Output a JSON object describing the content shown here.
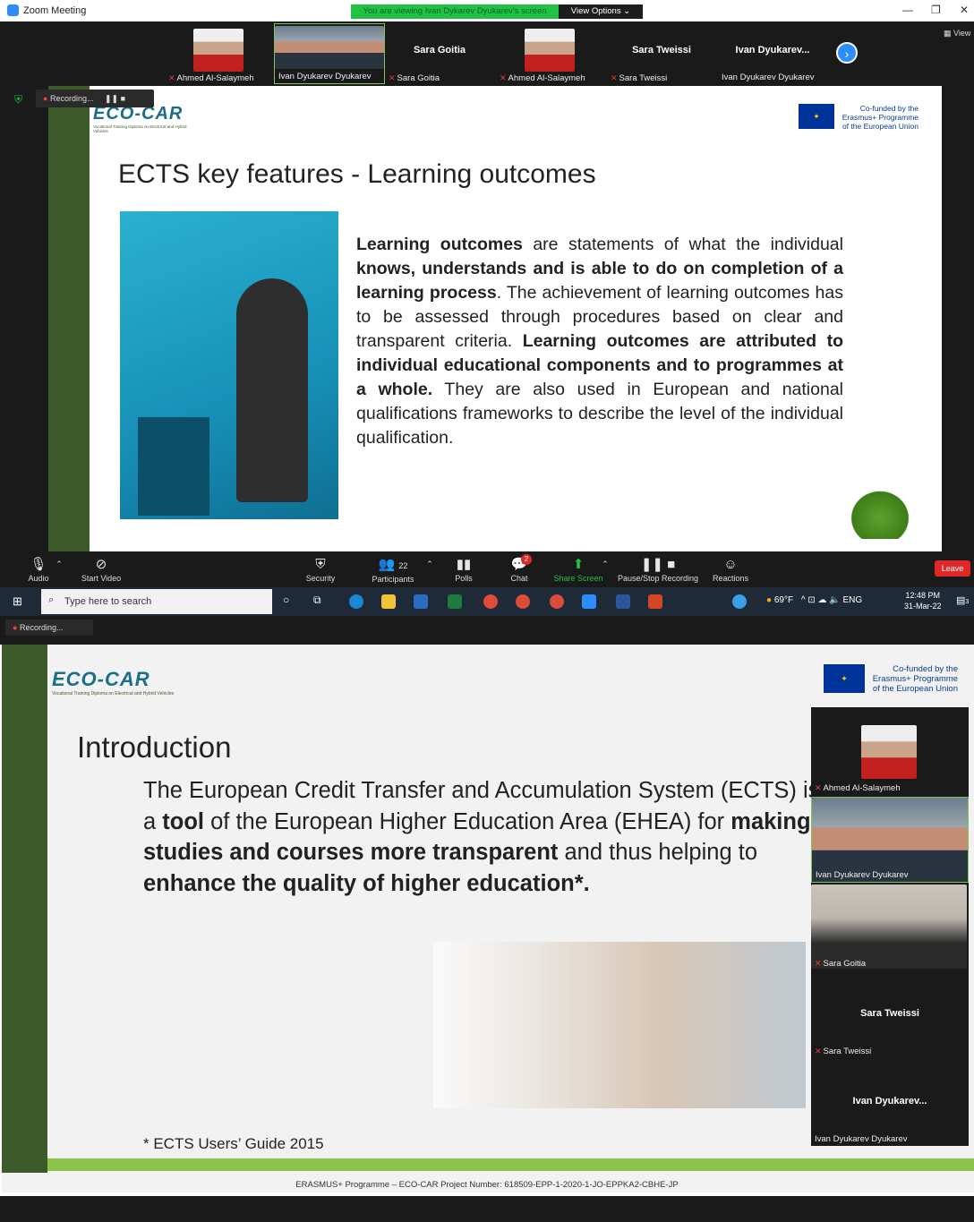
{
  "window": {
    "title": "Zoom Meeting",
    "banner": "You are viewing Ivan Dykarev Dyukarev's screen",
    "view_options": "View Options ⌄",
    "view_label": "View"
  },
  "participants_strip": [
    {
      "name": "Ahmed Al-Salaymeh",
      "muted": true,
      "video": true
    },
    {
      "name": "Ivan Dyukarev Dyukarev",
      "muted": false,
      "video": true
    },
    {
      "name": "Sara Goitia",
      "display": "Sara Goitia",
      "muted": true,
      "video": false
    },
    {
      "name": "Ahmed Al-Salaymeh",
      "muted": true,
      "video": true
    },
    {
      "name": "Sara Tweissi",
      "display": "Sara Tweissi",
      "muted": true,
      "video": false
    },
    {
      "name": "Ivan Dyukarev Dyukarev",
      "display": "Ivan  Dyukarev...",
      "muted": false,
      "video": false
    }
  ],
  "recording_label": "Recording...",
  "slide1": {
    "title": "ECTS key features - Learning outcomes",
    "logo": "ECO-CAR",
    "logo_sub": "Vocational Training Diploma on Electrical and Hybrid Vehicles",
    "cofunded": "Co-funded by the Erasmus+ Programme of the European Union",
    "p": [
      {
        "t": "Learning outcomes",
        "b": true
      },
      {
        "t": " are statements of what the individual ",
        "b": false
      },
      {
        "t": "knows, understands and is able to do on completion of a learning process",
        "b": true
      },
      {
        "t": ". The achievement of learning outcomes has to be assessed through procedures based on clear and transparent criteria. ",
        "b": false
      },
      {
        "t": "Learning outcomes are attributed to individual educational components and to programmes at a whole.",
        "b": true
      },
      {
        "t": " They are also used in European and national qualifications frameworks to describe the level of the individual qualification.",
        "b": false
      }
    ]
  },
  "toolbar": {
    "audio": "Audio",
    "start_video": "Start Video",
    "security": "Security",
    "participants": "Participants",
    "participants_count": "22",
    "polls": "Polls",
    "chat": "Chat",
    "chat_badge": "2",
    "share_screen": "Share Screen",
    "pause_recording": "Pause/Stop Recording",
    "reactions": "Reactions",
    "leave": "Leave"
  },
  "taskbar": {
    "search_placeholder": "Type here to search",
    "temperature": "69°F",
    "lang": "ENG",
    "time": "12:48 PM",
    "date": "31-Mar-22",
    "notif_count": "3"
  },
  "slide2": {
    "title": "Introduction",
    "p": [
      {
        "t": "The European Credit Transfer and Accumulation System (ECTS) is a ",
        "b": false
      },
      {
        "t": "tool",
        "b": true
      },
      {
        "t": " of the European Higher Education Area (EHEA) for ",
        "b": false
      },
      {
        "t": "making studies and courses more transparent",
        "b": true
      },
      {
        "t": " and thus helping to ",
        "b": false
      },
      {
        "t": "enhance the quality of higher education*.",
        "b": true
      }
    ],
    "footnote": "* ECTS Users’ Guide 2015",
    "footer": "ERASMUS+ Programme – ECO-CAR Project Number: 618509-EPP-1-2020-1-JO-EPPKA2-CBHE-JP"
  },
  "side_panel": [
    {
      "name": "Ahmed Al-Salaymeh",
      "muted": true,
      "video": true
    },
    {
      "name": "Ivan Dyukarev Dyukarev",
      "muted": false,
      "video": true
    },
    {
      "name": "Sara Goitia",
      "muted": true,
      "video": true
    },
    {
      "name": "Sara Tweissi",
      "display": "Sara Tweissi",
      "muted": true,
      "video": false
    },
    {
      "name": "Ivan Dyukarev Dyukarev",
      "display": "Ivan  Dyukarev...",
      "muted": false,
      "video": false
    }
  ],
  "colors": {
    "zoom_blue": "#2d8cff",
    "banner_green": "#22c043",
    "leave_red": "#e02828",
    "slide_green": "#3c5a2a",
    "footer_green": "#8cc34a"
  }
}
